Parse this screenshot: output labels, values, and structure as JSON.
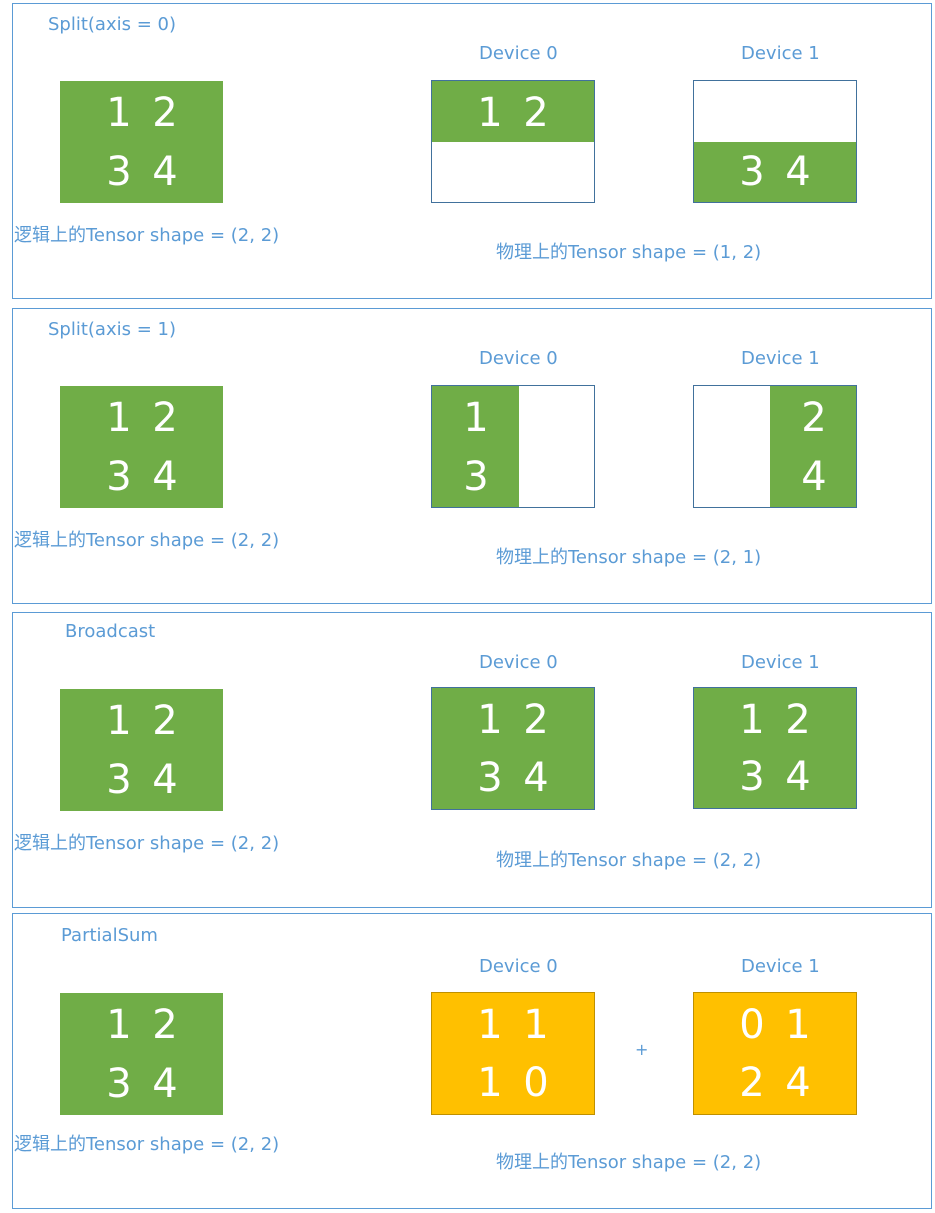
{
  "colors": {
    "green": "#70ad47",
    "orange": "#ffc000",
    "border": "#5b9bd5",
    "text": "#5b9bd5"
  },
  "panels": [
    {
      "title": "Split(axis = 0)",
      "logical": {
        "values": [
          "1",
          "2",
          "3",
          "4"
        ],
        "shape_label": "逻辑上的Tensor shape =  (2, 2)"
      },
      "device0": {
        "label": "Device 0",
        "values": [
          "1",
          "2"
        ]
      },
      "device1": {
        "label": "Device 1",
        "values": [
          "3",
          "4"
        ]
      },
      "physical_shape_label": "物理上的Tensor shape =  (1, 2)"
    },
    {
      "title": "Split(axis = 1)",
      "logical": {
        "values": [
          "1",
          "2",
          "3",
          "4"
        ],
        "shape_label": "逻辑上的Tensor shape =  (2, 2)"
      },
      "device0": {
        "label": "Device 0",
        "values": [
          "1",
          "3"
        ]
      },
      "device1": {
        "label": "Device 1",
        "values": [
          "2",
          "4"
        ]
      },
      "physical_shape_label": "物理上的Tensor shape =  (2, 1)"
    },
    {
      "title": "Broadcast",
      "logical": {
        "values": [
          "1",
          "2",
          "3",
          "4"
        ],
        "shape_label": "逻辑上的Tensor shape =  (2, 2)"
      },
      "device0": {
        "label": "Device 0",
        "values": [
          "1",
          "2",
          "3",
          "4"
        ]
      },
      "device1": {
        "label": "Device 1",
        "values": [
          "1",
          "2",
          "3",
          "4"
        ]
      },
      "physical_shape_label": "物理上的Tensor shape =  (2, 2)"
    },
    {
      "title": "PartialSum",
      "logical": {
        "values": [
          "1",
          "2",
          "3",
          "4"
        ],
        "shape_label": "逻辑上的Tensor shape =  (2, 2)"
      },
      "device0": {
        "label": "Device 0",
        "values": [
          "1",
          "1",
          "1",
          "0"
        ]
      },
      "device1": {
        "label": "Device 1",
        "values": [
          "0",
          "1",
          "2",
          "4"
        ]
      },
      "operator": "+",
      "physical_shape_label": "物理上的Tensor shape =  (2, 2)"
    }
  ]
}
